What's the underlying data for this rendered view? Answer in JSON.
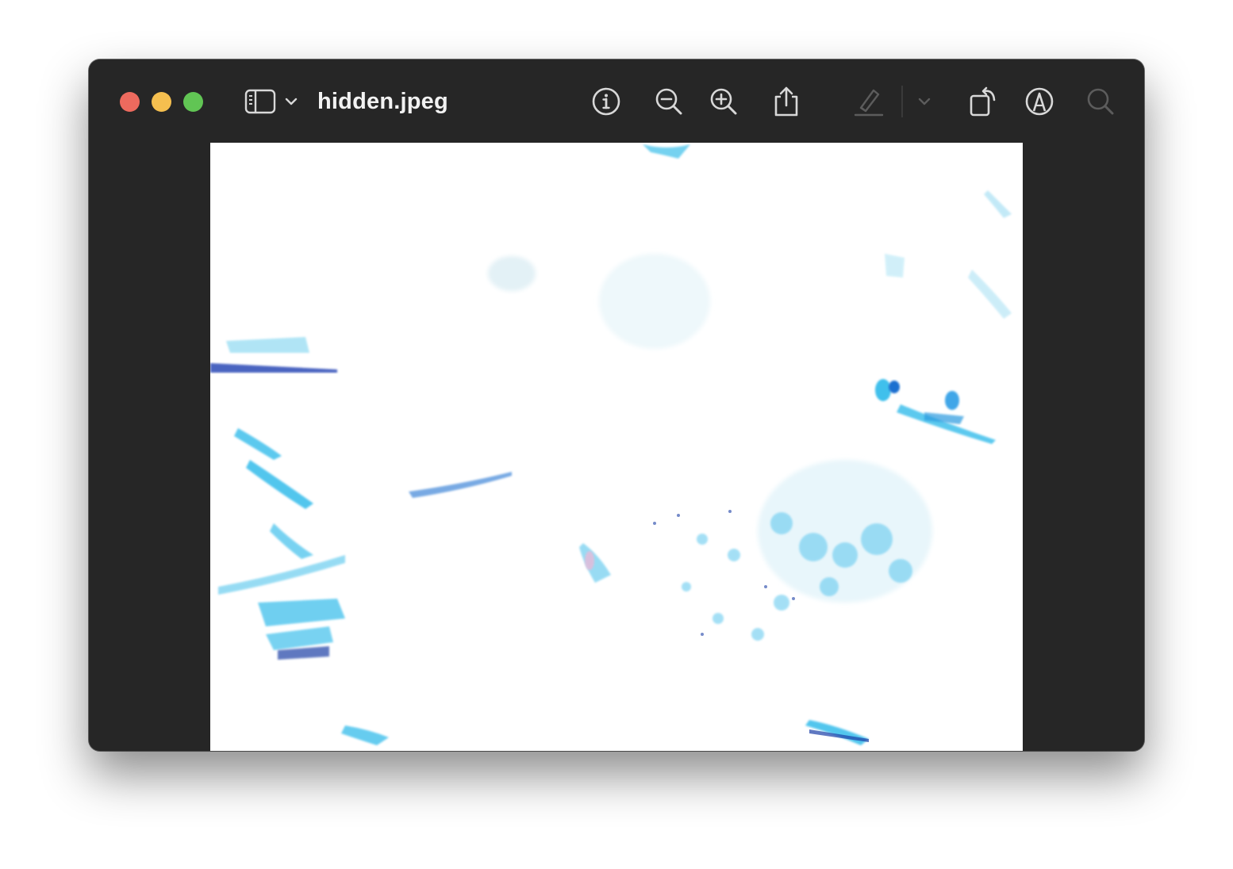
{
  "window": {
    "title": "hidden.jpeg"
  },
  "traffic_lights": {
    "close_color": "#ed6a5e",
    "minimize_color": "#f5bf4f",
    "zoom_color": "#61c554"
  },
  "toolbar": {
    "items": [
      {
        "name": "sidebar-toggle",
        "icon": "sidebar-icon"
      },
      {
        "name": "sidebar-menu",
        "icon": "chevron-down-icon"
      },
      {
        "name": "info",
        "icon": "info-icon"
      },
      {
        "name": "zoom-out",
        "icon": "zoom-out-icon"
      },
      {
        "name": "zoom-in",
        "icon": "zoom-in-icon"
      },
      {
        "name": "share",
        "icon": "share-icon"
      },
      {
        "name": "highlight",
        "icon": "highlighter-icon",
        "enabled": false
      },
      {
        "name": "highlight-menu",
        "icon": "chevron-down-icon",
        "enabled": false
      },
      {
        "name": "rotate",
        "icon": "rotate-icon"
      },
      {
        "name": "markup",
        "icon": "markup-pen-icon"
      },
      {
        "name": "search",
        "icon": "search-icon",
        "enabled": false
      }
    ],
    "icon_color": "#d8d8d8",
    "disabled_icon_color": "#5c5c5c"
  },
  "document": {
    "image_description_colors": {
      "background": "#ffffff",
      "accent": "#3fc0ec",
      "dark_accent": "#1b3fa6"
    }
  }
}
